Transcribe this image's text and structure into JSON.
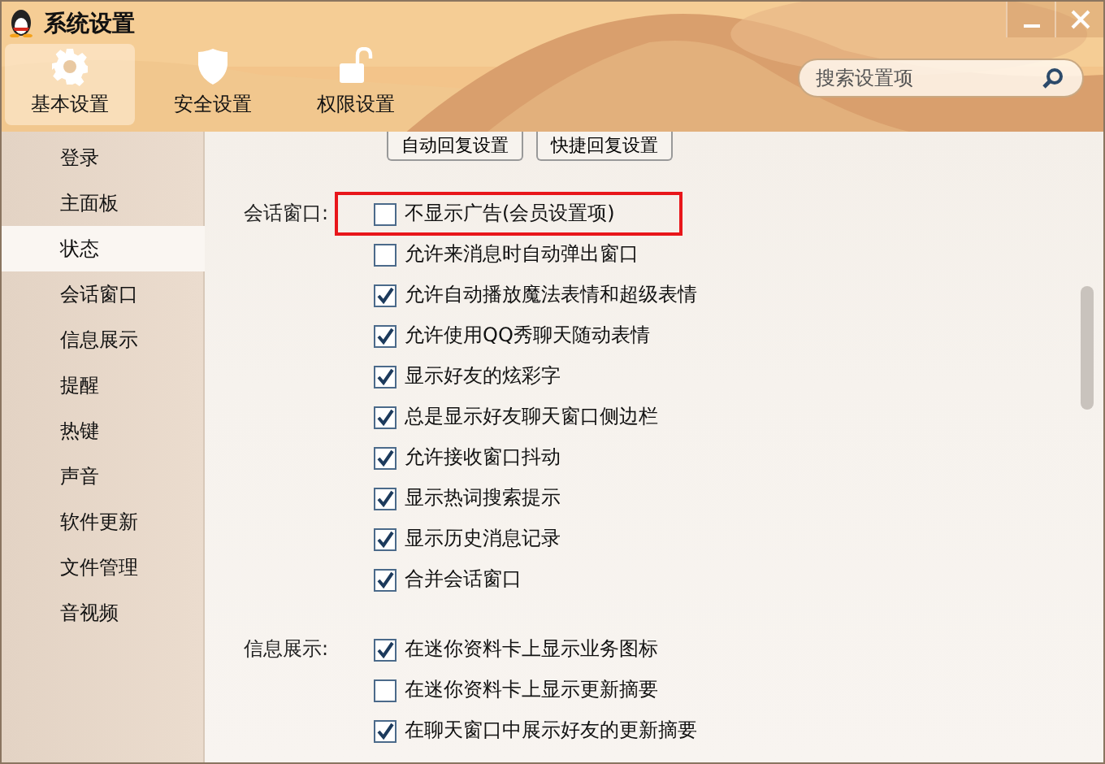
{
  "window": {
    "title": "系统设置"
  },
  "tabs": [
    {
      "label": "基本设置",
      "kind": "gear",
      "selected": true
    },
    {
      "label": "安全设置",
      "kind": "shield",
      "selected": false
    },
    {
      "label": "权限设置",
      "kind": "lock",
      "selected": false
    }
  ],
  "search": {
    "placeholder": "搜索设置项"
  },
  "sidebar": {
    "items": [
      {
        "label": "登录",
        "selected": false
      },
      {
        "label": "主面板",
        "selected": false
      },
      {
        "label": "状态",
        "selected": true
      },
      {
        "label": "会话窗口",
        "selected": false
      },
      {
        "label": "信息展示",
        "selected": false
      },
      {
        "label": "提醒",
        "selected": false
      },
      {
        "label": "热键",
        "selected": false
      },
      {
        "label": "声音",
        "selected": false
      },
      {
        "label": "软件更新",
        "selected": false
      },
      {
        "label": "文件管理",
        "selected": false
      },
      {
        "label": "音视频",
        "selected": false
      }
    ]
  },
  "buttons": [
    "自动回复设置",
    "快捷回复设置"
  ],
  "groups": [
    {
      "label": "会话窗口:",
      "options": [
        {
          "label": "不显示广告(会员设置项)",
          "checked": false,
          "highlighted": true
        },
        {
          "label": "允许来消息时自动弹出窗口",
          "checked": false,
          "highlighted": false
        },
        {
          "label": "允许自动播放魔法表情和超级表情",
          "checked": true,
          "highlighted": false
        },
        {
          "label": "允许使用QQ秀聊天随动表情",
          "checked": true,
          "highlighted": false
        },
        {
          "label": "显示好友的炫彩字",
          "checked": true,
          "highlighted": false
        },
        {
          "label": "总是显示好友聊天窗口侧边栏",
          "checked": true,
          "highlighted": false
        },
        {
          "label": "允许接收窗口抖动",
          "checked": true,
          "highlighted": false
        },
        {
          "label": "显示热词搜索提示",
          "checked": true,
          "highlighted": false
        },
        {
          "label": "显示历史消息记录",
          "checked": true,
          "highlighted": false
        },
        {
          "label": "合并会话窗口",
          "checked": true,
          "highlighted": false
        }
      ]
    },
    {
      "label": "信息展示:",
      "options": [
        {
          "label": "在迷你资料卡上显示业务图标",
          "checked": true,
          "highlighted": false
        },
        {
          "label": "在迷你资料卡上显示更新摘要",
          "checked": false,
          "highlighted": false
        },
        {
          "label": "在聊天窗口中展示好友的更新摘要",
          "checked": true,
          "highlighted": false
        }
      ]
    }
  ]
}
